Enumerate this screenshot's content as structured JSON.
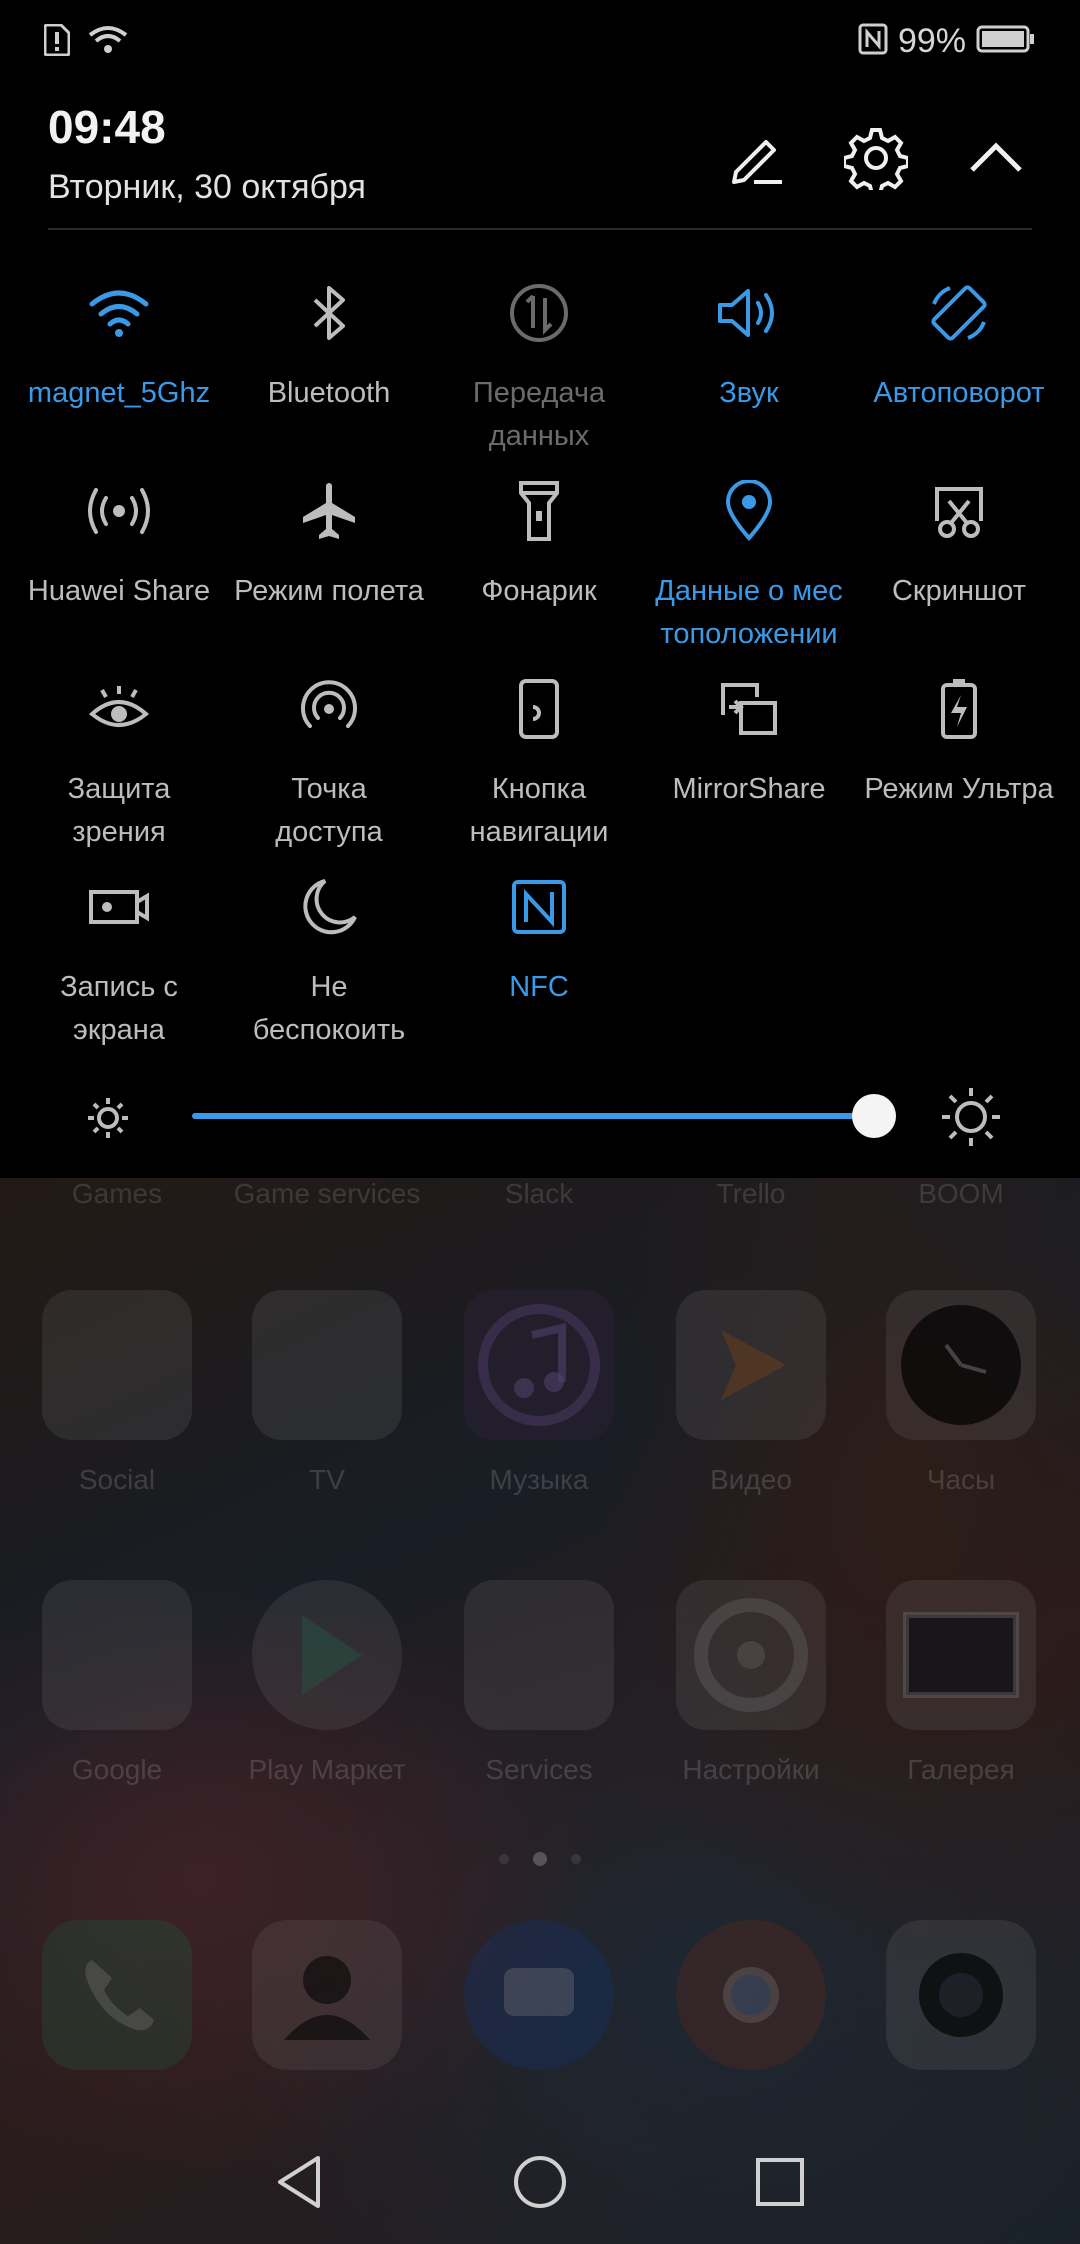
{
  "status_bar": {
    "battery_text": "99%",
    "icons": [
      "alert-icon",
      "wifi-icon",
      "nfc-icon",
      "battery-icon"
    ]
  },
  "header": {
    "time": "09:48",
    "date": "Вторник, 30 октября",
    "buttons": [
      "edit-icon",
      "settings-icon",
      "collapse-icon"
    ]
  },
  "tiles": [
    {
      "label": "magnet_5Ghz",
      "icon": "wifi-icon",
      "state": "on"
    },
    {
      "label": "Bluetooth",
      "icon": "bluetooth-icon",
      "state": "off"
    },
    {
      "label": "Передача\nданных",
      "icon": "mobile-data-icon",
      "state": "disabled"
    },
    {
      "label": "Звук",
      "icon": "sound-icon",
      "state": "on"
    },
    {
      "label": "Автоповорот",
      "icon": "auto-rotate-icon",
      "state": "on"
    },
    {
      "label": "Huawei Share",
      "icon": "huawei-share-icon",
      "state": "off"
    },
    {
      "label": "Режим полета",
      "icon": "airplane-icon",
      "state": "off"
    },
    {
      "label": "Фонарик",
      "icon": "flashlight-icon",
      "state": "off"
    },
    {
      "label": "Данные о мес\nтоположении",
      "icon": "location-icon",
      "state": "on"
    },
    {
      "label": "Скриншот",
      "icon": "screenshot-icon",
      "state": "off"
    },
    {
      "label": "Защита\nзрения",
      "icon": "eye-icon",
      "state": "off"
    },
    {
      "label": "Точка\nдоступа",
      "icon": "hotspot-icon",
      "state": "off"
    },
    {
      "label": "Кнопка\nнавигации",
      "icon": "nav-button-icon",
      "state": "off"
    },
    {
      "label": "MirrorShare",
      "icon": "mirrorshare-icon",
      "state": "off"
    },
    {
      "label": "Режим Ультра",
      "icon": "ultra-battery-icon",
      "state": "off"
    },
    {
      "label": "Запись с\nэкрана",
      "icon": "screen-record-icon",
      "state": "off"
    },
    {
      "label": "Не\nбеспокоить",
      "icon": "moon-icon",
      "state": "off"
    },
    {
      "label": "NFC",
      "icon": "nfc-icon",
      "state": "on"
    }
  ],
  "brightness": {
    "level": 0.96
  },
  "home": {
    "top_row_labels": [
      "Games",
      "Game services",
      "Slack",
      "Trello",
      "BOOM"
    ],
    "row1": [
      "Social",
      "TV",
      "Музыка",
      "Видео",
      "Часы"
    ],
    "row2": [
      "Google",
      "Play Маркет",
      "Services",
      "Настройки",
      "Галерея"
    ],
    "page_dots": 3,
    "active_page": 1,
    "dock": [
      "phone-icon",
      "contacts-icon",
      "messages-icon",
      "chrome-icon",
      "camera-icon"
    ]
  },
  "navbar": [
    "back-icon",
    "home-icon",
    "recents-icon"
  ],
  "colors": {
    "accent": "#3a9ae8",
    "tile_off": "#bdbdbd",
    "tile_disabled": "#6b6b6b"
  }
}
